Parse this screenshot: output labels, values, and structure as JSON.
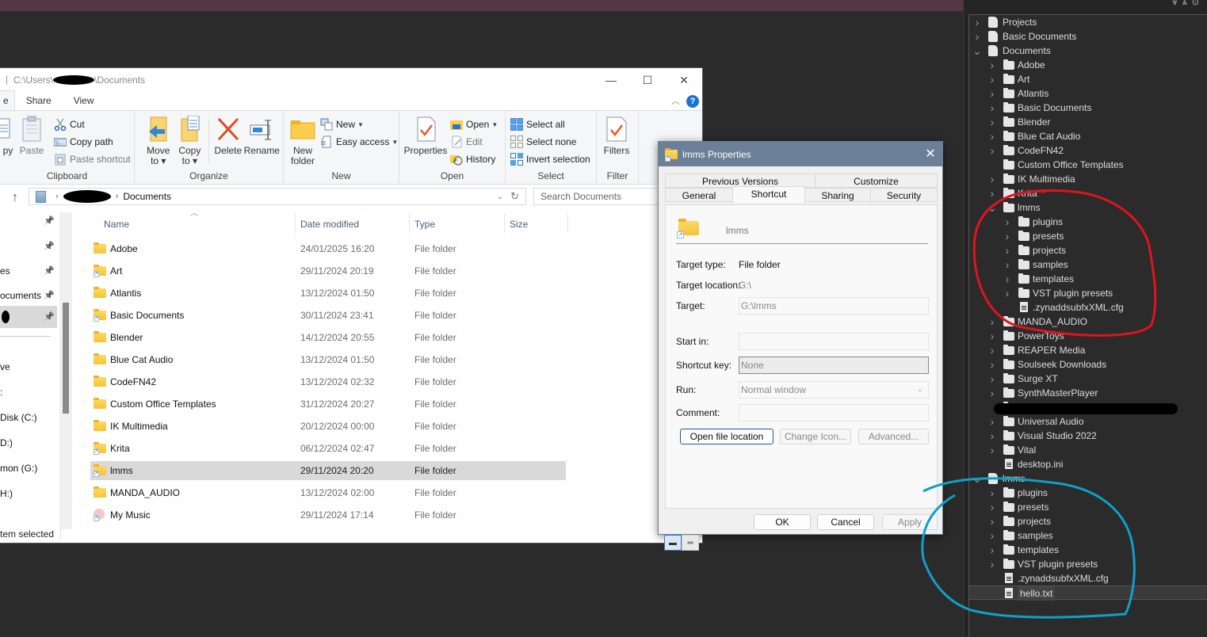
{
  "explorer": {
    "title_path": [
      "C:\\Users\\",
      "\\Documents"
    ],
    "window_controls": {
      "minimize": "—",
      "maximize": "☐",
      "close": "✕"
    },
    "tabs": [
      "e",
      "Share",
      "View"
    ],
    "ribbon": {
      "clipboard": {
        "label": "Clipboard",
        "copy": "py",
        "paste": "Paste",
        "cut": "Cut",
        "copy_path": "Copy path",
        "paste_shortcut": "Paste shortcut"
      },
      "organize": {
        "label": "Organize",
        "move_to": "Move to ▾",
        "copy_to": "Copy to ▾",
        "delete": "Delete",
        "rename": "Rename"
      },
      "new": {
        "label": "New",
        "new_folder": "New folder",
        "new_item": "New",
        "easy_access": "Easy access"
      },
      "open": {
        "label": "Open",
        "properties": "Properties",
        "open": "Open",
        "edit": "Edit",
        "history": "History"
      },
      "select": {
        "label": "Select",
        "select_all": "Select all",
        "select_none": "Select none",
        "invert_selection": "Invert selection"
      },
      "filter": {
        "label": "Filter",
        "filters": "Filters"
      }
    },
    "address": {
      "current": "Documents",
      "search_placeholder": "Search Documents"
    },
    "nav_items": [
      {
        "label": "",
        "pinned": true
      },
      {
        "label": "",
        "pinned": true
      },
      {
        "label": "es",
        "pinned": true
      },
      {
        "label": "ocuments",
        "pinned": true
      },
      {
        "label": "",
        "pinned": true,
        "selected": true
      },
      {
        "label": "ve"
      },
      {
        "label": ":"
      },
      {
        "label": "Disk (C:)"
      },
      {
        "label": "D:)"
      },
      {
        "label": "mon (G:)"
      },
      {
        "label": "H:)"
      }
    ],
    "columns": {
      "name": "Name",
      "date": "Date modified",
      "type": "Type",
      "size": "Size"
    },
    "files": [
      {
        "name": "Adobe",
        "date": "24/01/2025 16:20",
        "type": "File folder",
        "icon": "folder"
      },
      {
        "name": "Art",
        "date": "29/11/2024 20:19",
        "type": "File folder",
        "icon": "folder-shortcut"
      },
      {
        "name": "Atlantis",
        "date": "13/12/2024 01:50",
        "type": "File folder",
        "icon": "folder"
      },
      {
        "name": "Basic Documents",
        "date": "30/11/2024 23:41",
        "type": "File folder",
        "icon": "folder-shortcut"
      },
      {
        "name": "Blender",
        "date": "14/12/2024 20:55",
        "type": "File folder",
        "icon": "folder"
      },
      {
        "name": "Blue Cat Audio",
        "date": "13/12/2024 01:50",
        "type": "File folder",
        "icon": "folder"
      },
      {
        "name": "CodeFN42",
        "date": "13/12/2024 02:32",
        "type": "File folder",
        "icon": "folder"
      },
      {
        "name": "Custom Office Templates",
        "date": "31/12/2024 20:27",
        "type": "File folder",
        "icon": "folder"
      },
      {
        "name": "IK Multimedia",
        "date": "20/12/2024 00:00",
        "type": "File folder",
        "icon": "folder"
      },
      {
        "name": "Krita",
        "date": "06/12/2024 02:47",
        "type": "File folder",
        "icon": "folder-shortcut"
      },
      {
        "name": "lmms",
        "date": "29/11/2024 20:20",
        "type": "File folder",
        "icon": "folder-shortcut",
        "selected": true
      },
      {
        "name": "MANDA_AUDIO",
        "date": "13/12/2024 02:00",
        "type": "File folder",
        "icon": "folder"
      },
      {
        "name": "My Music",
        "date": "29/11/2024 17:14",
        "type": "File folder",
        "icon": "music-shortcut"
      }
    ],
    "status": "tem selected"
  },
  "properties": {
    "title": "lmms Properties",
    "tabs_row1": [
      "Previous Versions",
      "Customize"
    ],
    "tabs_row2": [
      "General",
      "Shortcut",
      "Sharing",
      "Security"
    ],
    "active_tab": "Shortcut",
    "name": "lmms",
    "fields": {
      "target_type_label": "Target type:",
      "target_type": "File folder",
      "target_location_label": "Target location:",
      "target_location": "G:\\",
      "target_label": "Target:",
      "target": "G:\\lmms",
      "start_in_label": "Start in:",
      "start_in": "",
      "shortcut_key_label": "Shortcut key:",
      "shortcut_key": "None",
      "run_label": "Run:",
      "run": "Normal window",
      "comment_label": "Comment:",
      "comment": ""
    },
    "buttons": {
      "open_location": "Open file location",
      "change_icon": "Change Icon...",
      "advanced": "Advanced...",
      "ok": "OK",
      "cancel": "Cancel",
      "apply": "Apply"
    }
  },
  "tree": {
    "items": [
      {
        "label": "Projects",
        "depth": 0,
        "icon": "library",
        "twisty": ">"
      },
      {
        "label": "Basic Documents",
        "depth": 0,
        "icon": "library",
        "twisty": ">"
      },
      {
        "label": "Documents",
        "depth": 0,
        "icon": "library",
        "twisty": "v"
      },
      {
        "label": "Adobe",
        "depth": 1,
        "icon": "folder",
        "twisty": ">"
      },
      {
        "label": "Art",
        "depth": 1,
        "icon": "folder",
        "twisty": ">"
      },
      {
        "label": "Atlantis",
        "depth": 1,
        "icon": "folder",
        "twisty": ">"
      },
      {
        "label": "Basic Documents",
        "depth": 1,
        "icon": "folder",
        "twisty": ">"
      },
      {
        "label": "Blender",
        "depth": 1,
        "icon": "folder",
        "twisty": ">"
      },
      {
        "label": "Blue Cat Audio",
        "depth": 1,
        "icon": "folder",
        "twisty": ">"
      },
      {
        "label": "CodeFN42",
        "depth": 1,
        "icon": "folder",
        "twisty": ">"
      },
      {
        "label": "Custom Office Templates",
        "depth": 1,
        "icon": "folder",
        "twisty": ""
      },
      {
        "label": "IK Multimedia",
        "depth": 1,
        "icon": "folder",
        "twisty": ">"
      },
      {
        "label": "Krita",
        "depth": 1,
        "icon": "folder",
        "twisty": ">"
      },
      {
        "label": "lmms",
        "depth": 1,
        "icon": "folder-open",
        "twisty": "v"
      },
      {
        "label": "plugins",
        "depth": 2,
        "icon": "folder",
        "twisty": ">"
      },
      {
        "label": "presets",
        "depth": 2,
        "icon": "folder",
        "twisty": ">"
      },
      {
        "label": "projects",
        "depth": 2,
        "icon": "folder",
        "twisty": ">"
      },
      {
        "label": "samples",
        "depth": 2,
        "icon": "folder",
        "twisty": ">"
      },
      {
        "label": "templates",
        "depth": 2,
        "icon": "folder",
        "twisty": ">"
      },
      {
        "label": "VST plugin presets",
        "depth": 2,
        "icon": "folder",
        "twisty": ">"
      },
      {
        "label": ".zynaddsubfxXML.cfg",
        "depth": 2,
        "icon": "file",
        "twisty": ""
      },
      {
        "label": "MANDA_AUDIO",
        "depth": 1,
        "icon": "folder",
        "twisty": ">"
      },
      {
        "label": "PowerToys",
        "depth": 1,
        "icon": "folder",
        "twisty": ">"
      },
      {
        "label": "REAPER Media",
        "depth": 1,
        "icon": "folder",
        "twisty": ">"
      },
      {
        "label": "Soulseek Downloads",
        "depth": 1,
        "icon": "folder",
        "twisty": ">"
      },
      {
        "label": "Surge XT",
        "depth": 1,
        "icon": "folder",
        "twisty": ">"
      },
      {
        "label": "SynthMasterPlayer",
        "depth": 1,
        "icon": "folder",
        "twisty": ">"
      },
      {
        "label": "",
        "depth": 1,
        "icon": "folder",
        "twisty": "",
        "redacted": true
      },
      {
        "label": "Universal Audio",
        "depth": 1,
        "icon": "folder",
        "twisty": ">"
      },
      {
        "label": "Visual Studio 2022",
        "depth": 1,
        "icon": "folder",
        "twisty": ">"
      },
      {
        "label": "Vital",
        "depth": 1,
        "icon": "folder",
        "twisty": ">"
      },
      {
        "label": "desktop.ini",
        "depth": 1,
        "icon": "file",
        "twisty": ""
      },
      {
        "label": "lmms",
        "depth": 0,
        "icon": "library",
        "twisty": "v"
      },
      {
        "label": "plugins",
        "depth": 1,
        "icon": "folder",
        "twisty": ">"
      },
      {
        "label": "presets",
        "depth": 1,
        "icon": "folder",
        "twisty": ">"
      },
      {
        "label": "projects",
        "depth": 1,
        "icon": "folder",
        "twisty": ">"
      },
      {
        "label": "samples",
        "depth": 1,
        "icon": "folder",
        "twisty": ">"
      },
      {
        "label": "templates",
        "depth": 1,
        "icon": "folder",
        "twisty": ">"
      },
      {
        "label": "VST plugin presets",
        "depth": 1,
        "icon": "folder",
        "twisty": ">"
      },
      {
        "label": ".zynaddsubfxXML.cfg",
        "depth": 1,
        "icon": "file",
        "twisty": ""
      },
      {
        "label": "hello.txt",
        "depth": 1,
        "icon": "file",
        "twisty": "",
        "selected": true
      }
    ]
  },
  "annotations": {
    "red": "#e0141e",
    "blue": "#10a0c8"
  }
}
